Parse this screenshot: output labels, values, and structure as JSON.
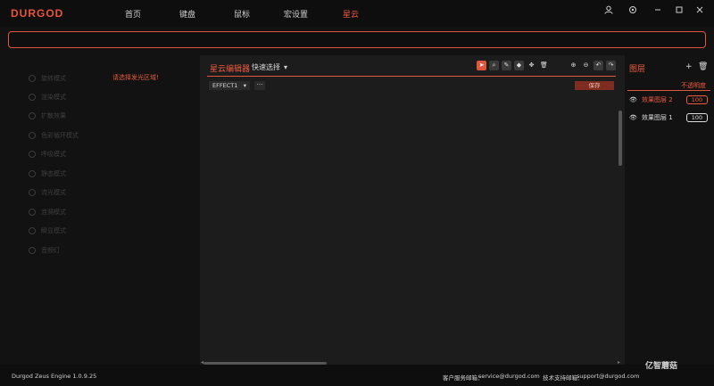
{
  "app": {
    "logo": "DURGOD",
    "nav": [
      "首页",
      "键盘",
      "鼠标",
      "宏设置",
      "星云"
    ],
    "active_nav": "星云"
  },
  "window_icons": {
    "user": "user-icon",
    "settings": "settings-icon",
    "minimize": "minimize-icon",
    "maximize": "maximize-icon",
    "close": "close-icon"
  },
  "search": {
    "value": "",
    "placeholder": ""
  },
  "left_panel": {
    "hint": "请选择发光区域!",
    "modes": [
      "旋转模式",
      "渲染模式",
      "扩散效果",
      "色彩循环模式",
      "呼吸模式",
      "静态模式",
      "流光模式",
      "涟漪模式",
      "瞬显模式",
      "音频灯"
    ]
  },
  "editor": {
    "title": "星云编辑器",
    "quick_select": "快速选择",
    "effect": "EFFECT1",
    "more": "···",
    "save": "保存",
    "tools": [
      "pointer-icon",
      "magnify-icon",
      "pen-icon",
      "paint-bucket-icon",
      "move-icon",
      "trash-icon"
    ],
    "zoom_tools": [
      "zoom-in-icon",
      "zoom-out-icon",
      "undo-icon",
      "redo-icon"
    ]
  },
  "layers": {
    "title": "图层",
    "add": "+",
    "delete": "🗑",
    "opacity_label": "不透明度",
    "items": [
      {
        "name": "效果图层 2",
        "opacity": "100",
        "active": true
      },
      {
        "name": "效果图层 1",
        "opacity": "100",
        "active": false
      }
    ]
  },
  "footer": {
    "version": "Durgod Zeus Engine 1.0.9.25",
    "service_label": "客户服务邮箱：",
    "service_email": "service@durgod.com",
    "support_label": "技术支持邮箱：",
    "support_email": "support@durgod.com",
    "watermark": "亿智蘑菇"
  },
  "colors": {
    "accent": "#e0563b",
    "bg": "#121212",
    "panel": "#1c1c1c"
  }
}
